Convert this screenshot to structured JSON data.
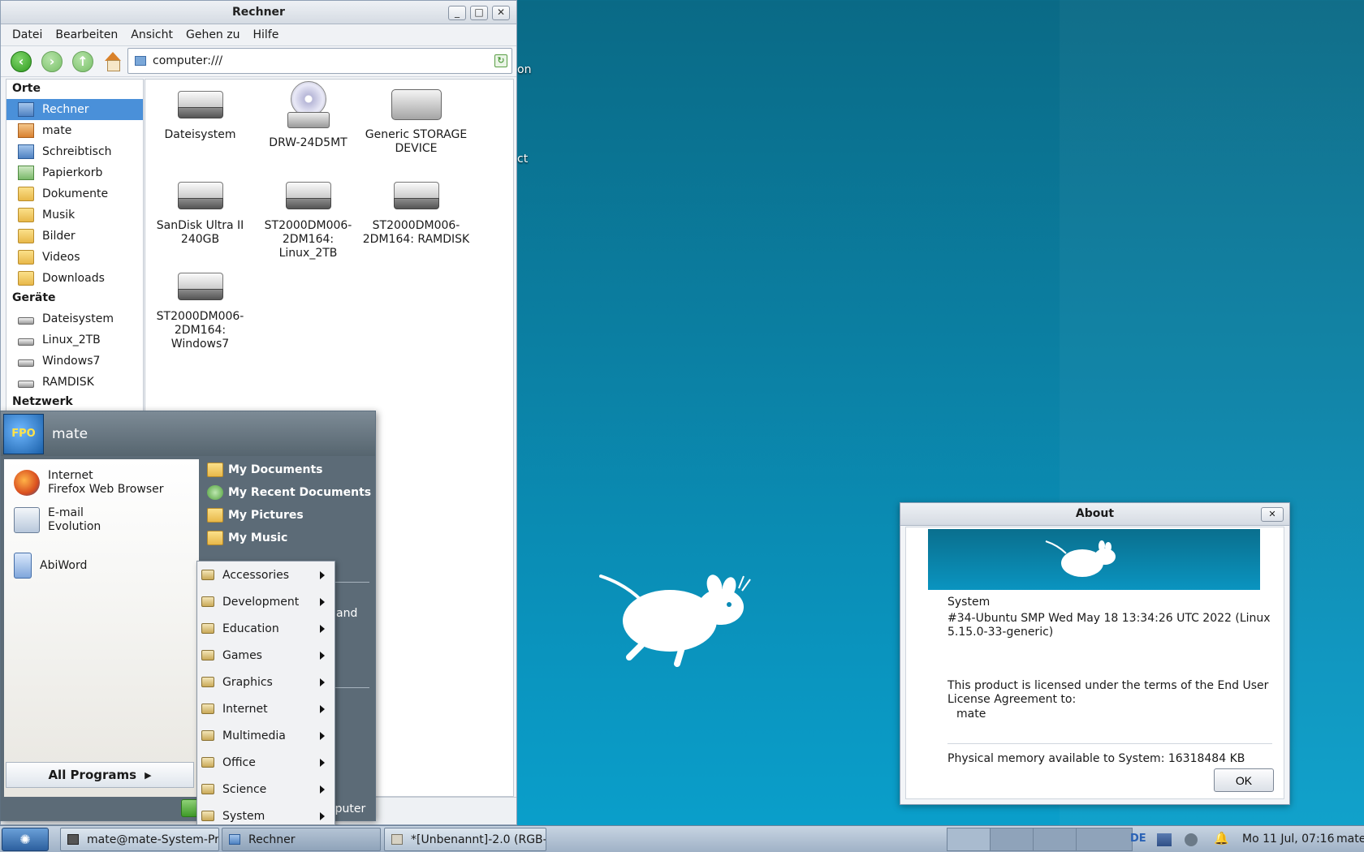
{
  "file_manager": {
    "title": "Rechner",
    "menu": [
      "Datei",
      "Bearbeiten",
      "Ansicht",
      "Gehen zu",
      "Hilfe"
    ],
    "location": "computer:///",
    "sidebar": {
      "places_header": "Orte",
      "places": [
        "Rechner",
        "mate",
        "Schreibtisch",
        "Papierkorb",
        "Dokumente",
        "Musik",
        "Bilder",
        "Videos",
        "Downloads"
      ],
      "devices_header": "Geräte",
      "devices": [
        "Dateisystem",
        "Linux_2TB",
        "Windows7",
        "RAMDISK"
      ],
      "network_header": "Netzwerk"
    },
    "items": [
      {
        "label": "Dateisystem",
        "icon": "hard-drive-icon"
      },
      {
        "label": "DRW-24D5MT",
        "icon": "optical-drive-icon"
      },
      {
        "label": "Generic STORAGE DEVICE",
        "icon": "storage-device-icon"
      },
      {
        "label": "SanDisk Ultra II 240GB",
        "icon": "hard-drive-icon"
      },
      {
        "label": "ST2000DM006-2DM164: Linux_2TB",
        "icon": "hard-drive-icon"
      },
      {
        "label": "ST2000DM006-2DM164: RAMDISK",
        "icon": "hard-drive-icon"
      },
      {
        "label": "ST2000DM006-2DM164: Windows7",
        "icon": "hard-drive-icon"
      }
    ]
  },
  "desktop": {
    "fragment_1": "on",
    "fragment_2": "ct"
  },
  "about": {
    "title": "About",
    "system_label": "System",
    "kernel": "#34-Ubuntu SMP Wed May 18 13:34:26 UTC 2022 (Linux 5.15.0-33-generic)",
    "license": "This product is licensed under the terms of the End User License Agreement to:",
    "licensee": "mate",
    "memory": "Physical memory available to System: 16318484 KB",
    "ok": "OK"
  },
  "start_menu": {
    "user": "mate",
    "avatar_text": "FPO",
    "apps": [
      {
        "title": "Internet",
        "subtitle": "Firefox Web Browser"
      },
      {
        "title": "E-mail",
        "subtitle": "Evolution"
      },
      {
        "title": "AbiWord",
        "subtitle": ""
      }
    ],
    "all_programs": "All Programs",
    "places": [
      "My Documents",
      "My Recent Documents",
      "My Pictures",
      "My Music"
    ],
    "partial_and": "and",
    "partial_computer": "mputer"
  },
  "programs_submenu": [
    "Accessories",
    "Development",
    "Education",
    "Games",
    "Graphics",
    "Internet",
    "Multimedia",
    "Office",
    "Science",
    "System"
  ],
  "taskbar": {
    "tasks": [
      "mate@mate-System-Pr...",
      "Rechner",
      "*[Unbenannt]-2.0 (RGB-..."
    ],
    "keyboard_layout": "DE",
    "clock": "Mo 11 Jul, 07:16",
    "user": "mate"
  }
}
